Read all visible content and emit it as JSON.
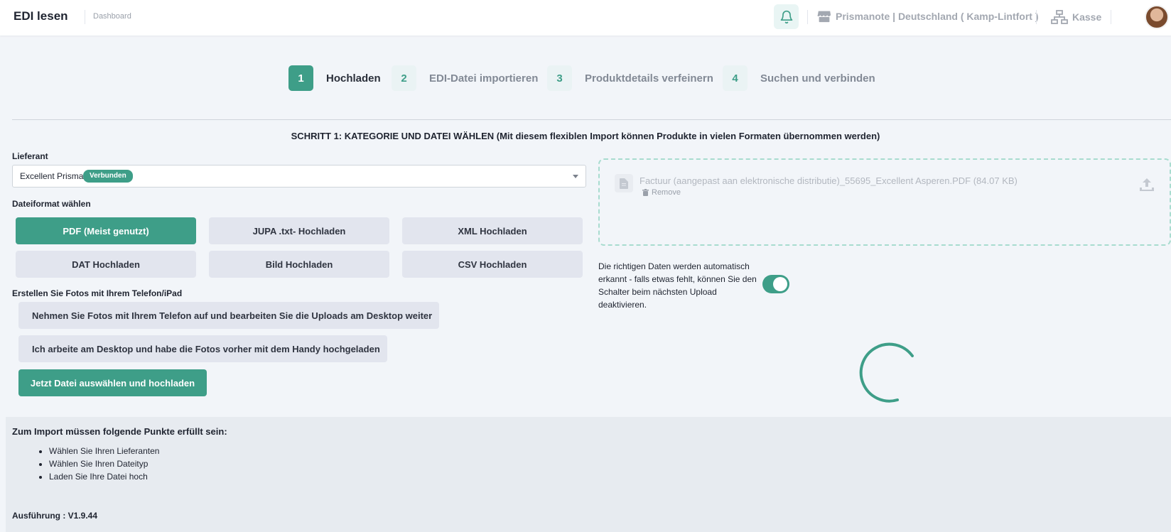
{
  "header": {
    "title": "EDI lesen",
    "breadcrumb": "Dashboard",
    "shop": "Prismanote | Deutschland ( Kamp-Lintfort )",
    "register": "Kasse",
    "icons": [
      "bell-icon",
      "store-icon",
      "network-icon"
    ]
  },
  "steps": [
    {
      "num": "1",
      "label": "Hochladen",
      "active": true
    },
    {
      "num": "2",
      "label": "EDI-Datei importieren"
    },
    {
      "num": "3",
      "label": "Produktdetails verfeinern"
    },
    {
      "num": "4",
      "label": "Suchen und verbinden"
    }
  ],
  "section_title": "SCHRITT 1: KATEGORIE UND DATEI WÄHLEN (Mit diesem flexiblen Import können Produkte in vielen Formaten übernommen werden)",
  "supplier": {
    "label": "Lieferant",
    "value": "Excellent Prisma",
    "badge": "Verbunden"
  },
  "format": {
    "label": "Dateiformat wählen",
    "buttons": [
      "PDF (Meist genutzt)",
      "JUPA .txt- Hochladen",
      "XML Hochladen",
      "DAT Hochladen",
      "Bild Hochladen",
      "CSV Hochladen"
    ],
    "selected": "PDF (Meist genutzt)"
  },
  "photos": {
    "label": "Erstellen Sie Fotos mit Ihrem Telefon/iPad",
    "phone_button": "Nehmen Sie Fotos mit Ihrem Telefon auf und bearbeiten Sie die Uploads am Desktop weiter",
    "desktop_button": "Ich arbeite am Desktop und habe die Fotos vorher mit dem Handy hochgeladen",
    "upload_button": "Jetzt Datei auswählen und hochladen"
  },
  "dropzone": {
    "file": "Factuur (aangepast aan elektronische distributie)_55695_Excellent Asperen.PDF (84.07 KB)",
    "remove": "Remove"
  },
  "toggle": {
    "text": "Die richtigen Daten werden automatisch erkannt - falls etwas fehlt, können Sie den Schalter beim nächsten Upload deaktivieren.",
    "on": true
  },
  "requirements": {
    "title": "Zum Import müssen folgende Punkte erfüllt sein:",
    "items": [
      "Wählen Sie Ihren Lieferanten",
      "Wählen Sie Ihren Dateityp",
      "Laden Sie Ihre Datei hoch"
    ],
    "version": "Ausführung : V1.9.44"
  },
  "colors": {
    "accent": "#3e9e88",
    "background": "#f2f5f9",
    "button_gray": "#e2e5ee"
  }
}
